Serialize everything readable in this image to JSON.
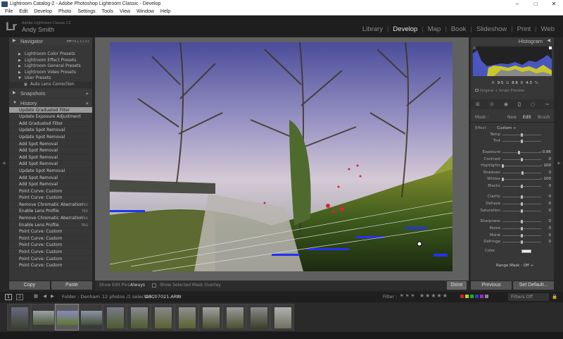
{
  "window": {
    "title": "Lightroom Catalog-2 - Adobe Photoshop Lightroom Classic - Develop",
    "minimize": "–",
    "maximize": "□",
    "close": "✕"
  },
  "menu": [
    "File",
    "Edit",
    "Develop",
    "Photo",
    "Settings",
    "Tools",
    "View",
    "Window",
    "Help"
  ],
  "identity": {
    "logo": "Lr",
    "catalog": "Adobe Lightroom Classic CC",
    "user": "Andy Smith"
  },
  "modules": [
    "Library",
    "Develop",
    "Map",
    "Book",
    "Slideshow",
    "Print",
    "Web"
  ],
  "active_module": "Develop",
  "navigator": {
    "title": "Navigator",
    "zoom": [
      "FIT",
      "FILL",
      "1:1",
      "3:1"
    ]
  },
  "presets": [
    {
      "label": "Lightroom Color Presets"
    },
    {
      "label": "Lightroom Effect Presets"
    },
    {
      "label": "Lightroom General Presets"
    },
    {
      "label": "Lightroom Video Presets"
    },
    {
      "label": "User Presets"
    },
    {
      "label": "Auto Lens Correction"
    }
  ],
  "snapshots": {
    "title": "Snapshots",
    "add": "+"
  },
  "history": {
    "title": "History",
    "clear": "×",
    "items": [
      {
        "label": "Update Graduated Filter",
        "value": ""
      },
      {
        "label": "Update Exposure Adjustment",
        "value": ""
      },
      {
        "label": "Add Graduated Filter",
        "value": ""
      },
      {
        "label": "Update Spot Removal",
        "value": ""
      },
      {
        "label": "Update Spot Removal",
        "value": ""
      },
      {
        "label": "Add Spot Removal",
        "value": ""
      },
      {
        "label": "Add Spot Removal",
        "value": ""
      },
      {
        "label": "Add Spot Removal",
        "value": ""
      },
      {
        "label": "Add Spot Removal",
        "value": ""
      },
      {
        "label": "Update Spot Removal",
        "value": ""
      },
      {
        "label": "Add Spot Removal",
        "value": ""
      },
      {
        "label": "Add Spot Removal",
        "value": ""
      },
      {
        "label": "Point Curve: Custom",
        "value": ""
      },
      {
        "label": "Point Curve: Custom",
        "value": ""
      },
      {
        "label": "Remove Chromatic Aberration",
        "value": "No"
      },
      {
        "label": "Enable Lens Profile",
        "value": "No"
      },
      {
        "label": "Remove Chromatic Aberration",
        "value": "Yes"
      },
      {
        "label": "Enable Lens Profile",
        "value": "Yes"
      },
      {
        "label": "Point Curve: Custom",
        "value": ""
      },
      {
        "label": "Point Curve: Custom",
        "value": ""
      },
      {
        "label": "Point Curve: Custom",
        "value": ""
      },
      {
        "label": "Point Curve: Custom",
        "value": ""
      },
      {
        "label": "Point Curve: Custom",
        "value": ""
      },
      {
        "label": "Point Curve: Custom",
        "value": ""
      }
    ]
  },
  "left_buttons": {
    "copy": "Copy",
    "paste": "Paste"
  },
  "toolbar": {
    "show_edit_pins_label": "Show Edit Pins :",
    "show_edit_pins_value": "Always",
    "overlay_label": "Show Selected Mask Overlay",
    "done": "Done"
  },
  "histogram": {
    "title": "Histogram",
    "readout": [
      "R",
      "9.5",
      "G",
      "8.8",
      "B",
      "4.3",
      "%"
    ],
    "preview": "Original + Smart Preview"
  },
  "mask": {
    "label": "Mask :",
    "tabs": [
      "New",
      "Edit",
      "Brush"
    ]
  },
  "effect": {
    "label": "Effect :",
    "value": "Custom ÷"
  },
  "sliders": [
    {
      "label": "Temp",
      "pos": 0.5,
      "value": ""
    },
    {
      "label": "Tint",
      "pos": 0.5,
      "value": ""
    },
    {
      "label": "Exposure",
      "pos": 0.42,
      "value": "- 0.86"
    },
    {
      "label": "Contrast",
      "pos": 0.5,
      "value": "0"
    },
    {
      "label": "Highlights",
      "pos": 0.0,
      "value": "- 100"
    },
    {
      "label": "Shadows",
      "pos": 0.52,
      "value": "3"
    },
    {
      "label": "Whites",
      "pos": 0.0,
      "value": "- 100"
    },
    {
      "label": "Blacks",
      "pos": 0.5,
      "value": "0"
    },
    {
      "label": "Clarity",
      "pos": 0.5,
      "value": "0"
    },
    {
      "label": "Dehaze",
      "pos": 0.5,
      "value": "0"
    },
    {
      "label": "Saturation",
      "pos": 0.5,
      "value": "0"
    },
    {
      "label": "Sharpness",
      "pos": 0.5,
      "value": "0"
    },
    {
      "label": "Noise",
      "pos": 0.5,
      "value": "0"
    },
    {
      "label": "Moiré",
      "pos": 0.5,
      "value": "0"
    },
    {
      "label": "Defringe",
      "pos": 0.5,
      "value": "0"
    }
  ],
  "color_label": "Color",
  "range_mask": "Range Mask : Off ÷",
  "right_buttons": {
    "previous": "Previous",
    "set_default": "Set Default..."
  },
  "filmstrip_bar": {
    "screen1": "1",
    "screen2": "2",
    "folder": "Folder : Denham",
    "count": "12 photos /1 selected /",
    "file": "DSC07021.ARW",
    "filter_label": "Filter :",
    "filters_off": "Filters Off"
  },
  "colors": {
    "accent": "#e8e8e8",
    "panel": "#373737",
    "sky": "#5c6a8a",
    "red_clip": "#e0203a",
    "blue_clip": "#2233ee"
  }
}
